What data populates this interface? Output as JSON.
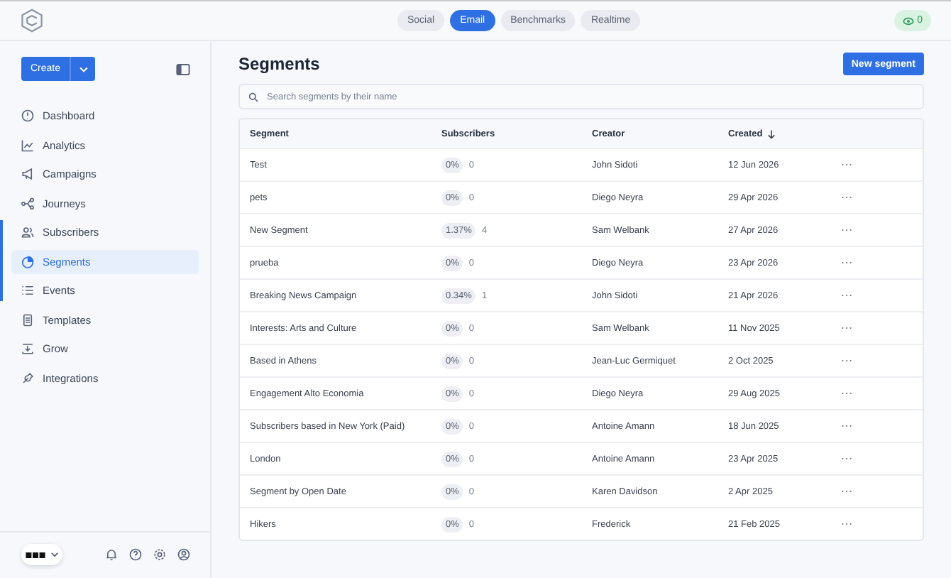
{
  "tabs": [
    {
      "label": "Social",
      "selected": false
    },
    {
      "label": "Email",
      "selected": true
    },
    {
      "label": "Benchmarks",
      "selected": false
    },
    {
      "label": "Realtime",
      "selected": false
    }
  ],
  "live_badge": {
    "count": "0"
  },
  "sidebar": {
    "create_button": "Create",
    "items": [
      {
        "label": "Dashboard",
        "kind": "dashboard",
        "selected": false
      },
      {
        "label": "Analytics",
        "kind": "analytics",
        "selected": false
      },
      {
        "label": "Campaigns",
        "kind": "campaigns",
        "selected": false
      },
      {
        "label": "Journeys",
        "kind": "journeys",
        "selected": false
      },
      {
        "label": "Subscribers",
        "kind": "subscribers",
        "selected": false
      },
      {
        "label": "Segments",
        "kind": "segments",
        "selected": true
      },
      {
        "label": "Events",
        "kind": "events",
        "selected": false
      },
      {
        "label": "Templates",
        "kind": "templates",
        "selected": false
      },
      {
        "label": "Grow",
        "kind": "grow",
        "selected": false
      },
      {
        "label": "Integrations",
        "kind": "integrations",
        "selected": false
      }
    ]
  },
  "page": {
    "title": "Segments",
    "new_button": "New segment",
    "search": {
      "placeholder": "Search segments by their name"
    }
  },
  "table": {
    "columns": [
      {
        "label": "Segment",
        "sorted": false
      },
      {
        "label": "Subscribers",
        "sorted": false
      },
      {
        "label": "Creator",
        "sorted": false
      },
      {
        "label": "Created",
        "sorted": true
      }
    ],
    "rows": [
      {
        "name": "Test",
        "share": "0%",
        "count": "0",
        "creator": "John Sidoti",
        "created": "12 Jun 2026"
      },
      {
        "name": "pets",
        "share": "0%",
        "count": "0",
        "creator": "Diego Neyra",
        "created": "29 Apr 2026"
      },
      {
        "name": "New Segment",
        "share": "1.37%",
        "count": "4",
        "creator": "Sam Welbank",
        "created": "27 Apr 2026"
      },
      {
        "name": "prueba",
        "share": "0%",
        "count": "0",
        "creator": "Diego Neyra",
        "created": "23 Apr 2026"
      },
      {
        "name": "Breaking News Campaign",
        "share": "0.34%",
        "count": "1",
        "creator": "John Sidoti",
        "created": "21 Apr 2026"
      },
      {
        "name": "Interests: Arts and Culture",
        "share": "0%",
        "count": "0",
        "creator": "Sam Welbank",
        "created": "11 Nov 2025"
      },
      {
        "name": "Based in Athens",
        "share": "0%",
        "count": "0",
        "creator": "Jean-Luc Germiquet",
        "created": "2 Oct 2025"
      },
      {
        "name": "Engagement Alto Economia",
        "share": "0%",
        "count": "0",
        "creator": "Diego Neyra",
        "created": "29 Aug 2025"
      },
      {
        "name": "Subscribers based in New York (Paid)",
        "share": "0%",
        "count": "0",
        "creator": "Antoine Amann",
        "created": "18 Jun 2025"
      },
      {
        "name": "London",
        "share": "0%",
        "count": "0",
        "creator": "Antoine Amann",
        "created": "23 Apr 2025"
      },
      {
        "name": "Segment by Open Date",
        "share": "0%",
        "count": "0",
        "creator": "Karen Davidson",
        "created": "2 Apr 2025"
      },
      {
        "name": "Hikers",
        "share": "0%",
        "count": "0",
        "creator": "Frederick",
        "created": "21 Feb 2025"
      }
    ]
  }
}
